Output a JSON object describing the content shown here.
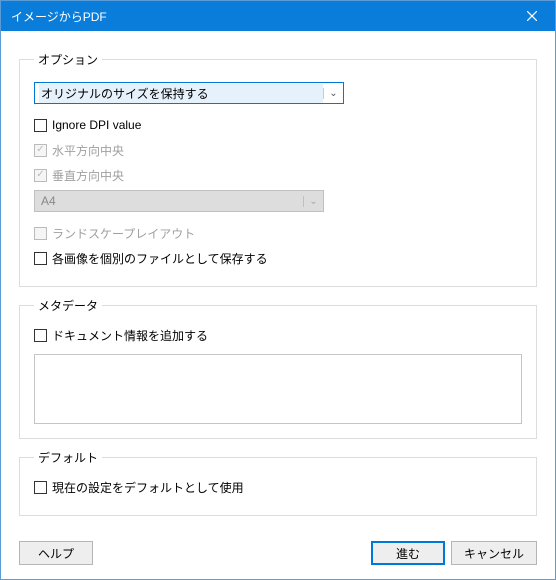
{
  "window": {
    "title": "イメージからPDF"
  },
  "options": {
    "legend": "オプション",
    "size_mode_selected": "オリジナルのサイズを保持する",
    "ignore_dpi": "Ignore DPI value",
    "center_h": "水平方向中央",
    "center_v": "垂直方向中央",
    "paper_selected": "A4",
    "landscape": "ランドスケープレイアウト",
    "save_each": "各画像を個別のファイルとして保存する"
  },
  "metadata": {
    "legend": "メタデータ",
    "add_doc_info": "ドキュメント情報を追加する"
  },
  "defaults": {
    "legend": "デフォルト",
    "use_current": "現在の設定をデフォルトとして使用"
  },
  "buttons": {
    "help": "ヘルプ",
    "ok": "進む",
    "cancel": "キャンセル"
  }
}
